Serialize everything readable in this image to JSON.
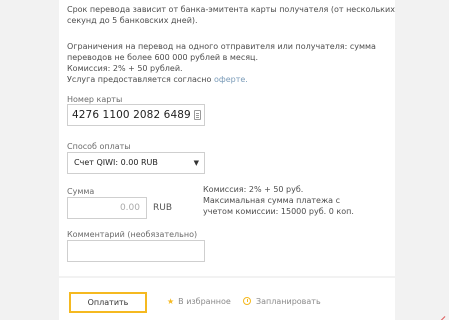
{
  "info": {
    "line1": "Срок перевода зависит от банка-эмитента карты получателя (от нескольких",
    "line2": "секунд до 5 банковских дней).",
    "limit_line1": "Ограничения на перевод на одного отправителя или получателя: сумма",
    "limit_line2": "переводов не более 600 000 рублей в месяц.",
    "commission": "Комиссия: 2% + 50 рублей.",
    "offer_prefix": "Услуга предоставляется согласно",
    "offer_link": "оферте."
  },
  "card_number": {
    "label": "Номер карты",
    "value": "4276 1100 2082 6489"
  },
  "payment_method": {
    "label": "Способ оплаты",
    "selected": "Счет QIWI: 0.00 RUB"
  },
  "amount": {
    "label": "Сумма",
    "value": "0.00",
    "currency": "RUB",
    "commission_note": "Комиссия: 2% + 50 руб.",
    "max_line1": "Максимальная сумма платежа с",
    "max_line2": "учетом комиссии: 15000 руб. 0 коп."
  },
  "comment": {
    "label": "Комментарий (необязательно)",
    "value": ""
  },
  "actions": {
    "pay": "Оплатить",
    "favorite": "В избранное",
    "schedule": "Запланировать"
  },
  "icons": {
    "favorite": "star-icon",
    "schedule": "clock-icon",
    "card": "card-scan-icon",
    "dropdown": "chevron-down-icon"
  },
  "colors": {
    "accent": "#f5b920",
    "link": "#7a9bb8",
    "background": "#f2f2f2"
  }
}
